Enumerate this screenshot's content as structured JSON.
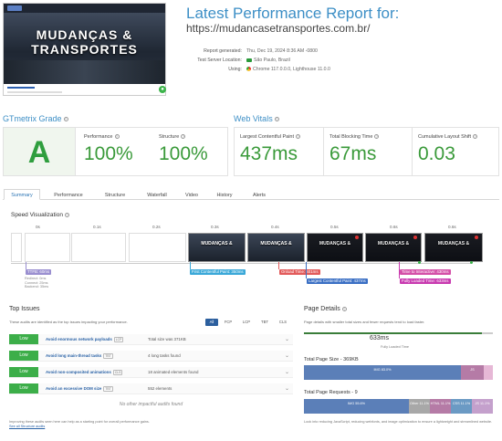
{
  "thumbnail": {
    "line1": "MUDANÇAS &",
    "line2": "TRANSPORTES"
  },
  "report": {
    "title": "Latest Performance Report for:",
    "url": "https://mudancasetransportes.com.br/",
    "meta": [
      {
        "label": "Report generated:",
        "value": "Thu, Dec 19, 2024 8:36 AM -0800"
      },
      {
        "label": "Test Server Location:",
        "value": "São Paulo, Brazil"
      },
      {
        "label": "Using:",
        "value": "Chrome 117.0.0.0, Lighthouse 11.0.0"
      }
    ]
  },
  "grade": {
    "heading": "GTmetrix Grade",
    "letter": "A",
    "performance_label": "Performance",
    "performance": "100%",
    "structure_label": "Structure",
    "structure": "100%"
  },
  "vitals": {
    "heading": "Web Vitals",
    "lcp_label": "Largest Contentful Paint",
    "lcp": "437ms",
    "tbt_label": "Total Blocking Time",
    "tbt": "67ms",
    "cls_label": "Cumulative Layout Shift",
    "cls": "0.03"
  },
  "tabs": [
    "Summary",
    "Performance",
    "Structure",
    "Waterfall",
    "Video",
    "History",
    "Alerts"
  ],
  "speed": {
    "title": "Speed Visualization",
    "ticks": [
      "0s",
      "0.1s",
      "0.2s",
      "0.3s",
      "0.4s",
      "0.5s",
      "0.6s"
    ],
    "frame_text1": "MUDANÇAS &",
    "frame_text2": "TRANSPORTES",
    "ttfb": "TTFB: 60ms",
    "ttfb_notes": "Redirect: 0ms Connect: 25ms Backend: 35ms",
    "fcp": "First Contentful Paint: 350ms",
    "onload": "Onload Time: 401ms",
    "lcp": "Largest Contentful Paint: 437ms",
    "tti": "Time to Interactive: 430ms",
    "fully": "Fully Loaded Time: 633ms"
  },
  "issues": {
    "title": "Top Issues",
    "desc": "These audits are identified as the top issues impacting your performance.",
    "filters": [
      "All",
      "FCP",
      "LCP",
      "TBT",
      "CLS"
    ],
    "rows": [
      {
        "badge": "Low",
        "title": "Avoid enormous network payloads",
        "tag": "LCP",
        "value": "Total size was 371KB"
      },
      {
        "badge": "Low",
        "title": "Avoid long main-thread tasks",
        "tag": "TBT",
        "value": "4 long tasks found"
      },
      {
        "badge": "Low",
        "title": "Avoid non-composited animations",
        "tag": "CLS",
        "value": "18 animated elements found"
      },
      {
        "badge": "Low",
        "title": "Avoid an excessive DOM size",
        "tag": "TBT",
        "value": "552 elements"
      }
    ],
    "none": "No other impactful audits found",
    "foot": "Improving these audits seen here can help as a starting point for overall performance gains.",
    "foot_link": "See all Structure audits"
  },
  "details": {
    "title": "Page Details",
    "desc": "Page details with smaller total sizes and fewer requests tend to load faster.",
    "fully_value": "633ms",
    "fully_caption": "Fully Loaded Time",
    "size_label": "Total Page Size - 369KB",
    "size_segments": [
      {
        "name": "IMG",
        "pct": "83.0%",
        "size": "306KB",
        "color": "#5b7fb8",
        "share": 0.83
      },
      {
        "name": "JS",
        "pct": "",
        "size": "",
        "color": "#b57ba6",
        "share": 0.12
      },
      {
        "name": "",
        "pct": "",
        "size": "",
        "color": "#e6b8d6",
        "share": 0.05
      }
    ],
    "req_label": "Total Page Requests - 9",
    "req_segments": [
      {
        "name": "IMG",
        "pct": "55.6%",
        "size": "5",
        "color": "#5b7fb8",
        "share": 0.556
      },
      {
        "name": "Other",
        "pct": "11.1%",
        "size": "1",
        "color": "#a8a8a8",
        "share": 0.111
      },
      {
        "name": "HTML",
        "pct": "11.1%",
        "size": "1",
        "color": "#b57ba6",
        "share": 0.111
      },
      {
        "name": "CSS",
        "pct": "11.1%",
        "size": "1",
        "color": "#6b9ac4",
        "share": 0.111
      },
      {
        "name": "JS",
        "pct": "11.1%",
        "size": "1",
        "color": "#c4a0cc",
        "share": 0.111
      }
    ],
    "foot": "Look into reducing JavaScript, reducing webfonts, and image optimization to ensure a lightweight and streamlined website."
  }
}
